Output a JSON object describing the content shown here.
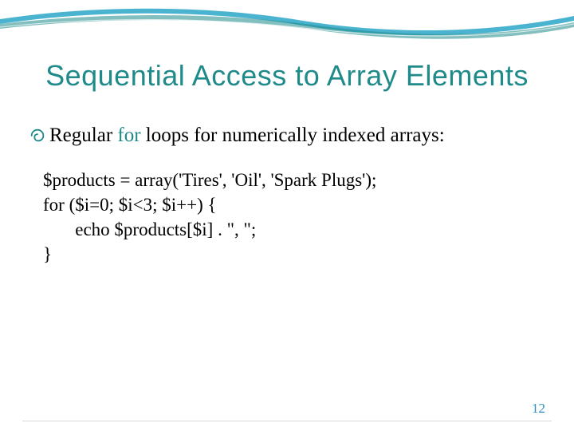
{
  "title": "Sequential Access to Array Elements",
  "bullet": {
    "pre": "Regular ",
    "keyword": "for",
    "post": " loops for numerically indexed arrays:"
  },
  "code": {
    "l1": "$products = array('Tires', 'Oil', 'Spark Plugs');",
    "l2": "for ($i=0; $i<3; $i++) {",
    "l3": "       echo $products[$i] . \", \";",
    "l4": "}"
  },
  "page_number": "12"
}
